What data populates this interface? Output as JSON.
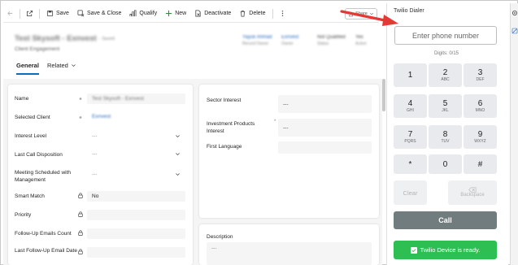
{
  "toolbar": {
    "save": "Save",
    "save_close": "Save & Close",
    "qualify": "Qualify",
    "new": "New",
    "deactivate": "Deactivate",
    "delete": "Delete",
    "share": "Share"
  },
  "header": {
    "title": "Test Skysoft - Exnvest",
    "title_suffix": "- Saved",
    "entity": "Client Engagement",
    "fields": [
      {
        "value": "Yayuk Ahmad",
        "label": "Record Owner"
      },
      {
        "value": "Exnvest",
        "label": "Owner"
      },
      {
        "value": "Not Qualified",
        "label": "Status"
      },
      {
        "value": "Yes",
        "label": "Active"
      }
    ]
  },
  "tabs": [
    {
      "label": "General"
    },
    {
      "label": "Related"
    }
  ],
  "left_form": {
    "name": {
      "label": "Name",
      "value": "Test Skysoft - Exnvest"
    },
    "selected_client": {
      "label": "Selected Client",
      "value": "Exnvest"
    },
    "interest_level": {
      "label": "Interest Level",
      "value": "---"
    },
    "last_call_disposition": {
      "label": "Last Call Disposition",
      "value": "---"
    },
    "meeting_scheduled": {
      "label": "Meeting Scheduled with Management",
      "value": "---"
    },
    "smart_match": {
      "label": "Smart Match",
      "value": "No"
    },
    "priority": {
      "label": "Priority",
      "value": ""
    },
    "follow_up_emails_count": {
      "label": "Follow-Up Emails Count",
      "value": ""
    },
    "last_follow_up_email_date": {
      "label": "Last Follow-Up Email Date",
      "value": ""
    }
  },
  "right_form": {
    "sector_interest": {
      "label": "Sector Interest",
      "value": "---"
    },
    "investment_products_interest": {
      "label": "Investment Products Interest",
      "value": "---",
      "required": "*"
    },
    "first_language": {
      "label": "First Language",
      "value": ""
    },
    "description": {
      "label": "Description",
      "value": "---"
    }
  },
  "dialer": {
    "title": "Twilio Dialer",
    "phone_placeholder": "Enter phone number",
    "digits": "Digits: 0/15",
    "keys": [
      {
        "digit": "1",
        "letters": ""
      },
      {
        "digit": "2",
        "letters": "ABC"
      },
      {
        "digit": "3",
        "letters": "DEF"
      },
      {
        "digit": "4",
        "letters": "GHI"
      },
      {
        "digit": "5",
        "letters": "JKL"
      },
      {
        "digit": "6",
        "letters": "MNO"
      },
      {
        "digit": "7",
        "letters": "PQRS"
      },
      {
        "digit": "8",
        "letters": "TUV"
      },
      {
        "digit": "9",
        "letters": "WXYZ"
      },
      {
        "digit": "*",
        "letters": ""
      },
      {
        "digit": "0",
        "letters": ""
      },
      {
        "digit": "#",
        "letters": ""
      }
    ],
    "clear": "Clear",
    "backspace": "Backspace",
    "call": "Call",
    "status": "Twilio Device is ready."
  },
  "colors": {
    "accent": "#0f6cbd",
    "call_button": "#707c7e",
    "ready": "#2ebf52",
    "annotation_arrow": "#e53935"
  }
}
